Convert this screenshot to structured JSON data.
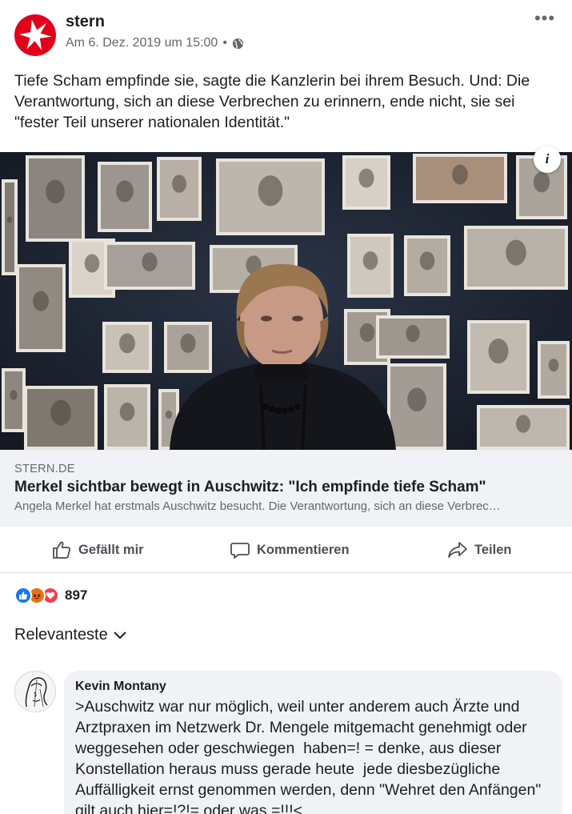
{
  "post": {
    "author": "stern",
    "timestamp": "Am 6. Dez. 2019 um 15:00",
    "separator": "•",
    "privacy_icon": "globe-icon",
    "more_icon": "more-options-icon",
    "text": "Tiefe Scham empfinde sie, sagte die Kanzlerin bei ihrem Besuch. Und: Die Verantwortung, sich an diese Verbrechen zu erinnern, ende nicht, sie sei \"fester Teil unserer nationalen Identität.\""
  },
  "link": {
    "info_label": "i",
    "domain": "STERN.DE",
    "title": "Merkel sichtbar bewegt in Auschwitz: \"Ich empfinde tiefe Scham\"",
    "description": "Angela Merkel hat erstmals Auschwitz besucht. Die Verantwortung, sich an diese Verbrec…"
  },
  "actions": {
    "like": "Gefällt mir",
    "comment": "Kommentieren",
    "share": "Teilen"
  },
  "reactions": {
    "count": "897",
    "types": [
      "like-reaction-icon",
      "angry-reaction-icon",
      "love-reaction-icon"
    ]
  },
  "comments": {
    "sort_label": "Relevanteste",
    "items": [
      {
        "author": "Kevin Montany",
        "text": ">Auschwitz war nur möglich, weil unter anderem auch Ärzte und Arztpraxen im Netzwerk Dr. Mengele mitgemacht genehmigt oder weggesehen oder geschwiegen  haben=! = denke, aus dieser Konstellation heraus muss gerade heute  jede diesbezügliche Auffälligkeit ernst genommen werden, denn \"Wehret den Anfängen\" gilt auch hier=!?!= oder was =!!!<"
      }
    ]
  },
  "colors": {
    "brand_red": "#e2001a",
    "facebook_blue": "#1877f2",
    "secondary_text": "#65676b",
    "card_background": "#f0f2f5"
  }
}
